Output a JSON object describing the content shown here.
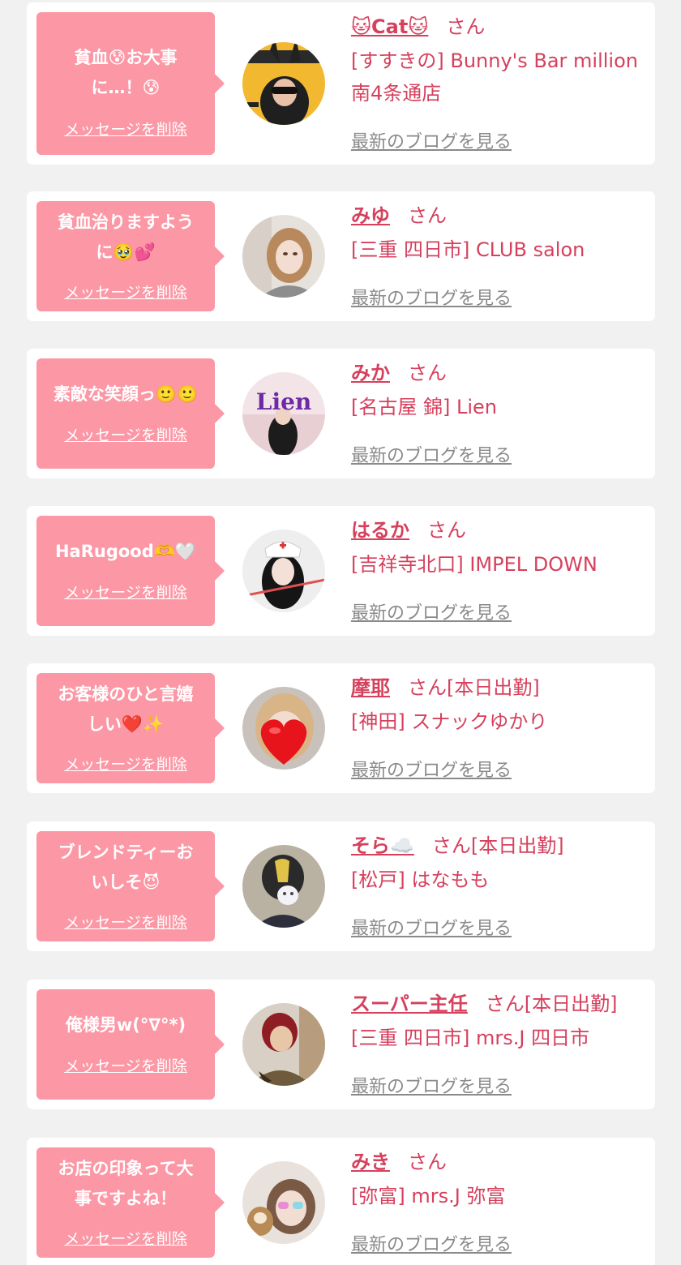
{
  "colors": {
    "background": "#f1f1f1",
    "card": "#ffffff",
    "bubble": "#fc97a5",
    "accent": "#d6405d",
    "link_gray": "#8a8a8a"
  },
  "delete_label": "メッセージを削除",
  "blog_label": "最新のブログを見る",
  "items": [
    {
      "message": "貧血😰お大事\nに…！😰",
      "name": "🐱Cat🐱",
      "honorific": "さん",
      "shop": "[すすきの] Bunny's Bar million\n南4条通店"
    },
    {
      "message": "貧血治りますよう\nに🥹💕",
      "name": "みゆ",
      "honorific": "さん",
      "shop": "[三重 四日市] CLUB salon"
    },
    {
      "message": "素敵な笑顔っ🙂🙂",
      "name": "みか",
      "honorific": "さん",
      "shop": "[名古屋 錦] Lien",
      "avatar_text": "Lien"
    },
    {
      "message": "HaRugood🫶🤍",
      "name": "はるか",
      "honorific": "さん",
      "shop": "[吉祥寺北口] IMPEL DOWN"
    },
    {
      "message": "お客様のひと言嬉\nしい❤️✨",
      "name": "摩耶",
      "honorific": "さん[本日出勤]",
      "shop": "[神田] スナックゆかり"
    },
    {
      "message": "ブレンドティーお\nいしそ😈",
      "name": "そら☁️",
      "honorific": "さん[本日出勤]",
      "shop": "[松戸] はなもも"
    },
    {
      "message": "俺様男w(°∇°*)",
      "name": "スーパー主任",
      "honorific": "さん[本日出勤]",
      "shop": "[三重 四日市] mrs.J 四日市"
    },
    {
      "message": "お店の印象って大\n事ですよね！",
      "name": "みき",
      "honorific": "さん",
      "shop": "[弥富] mrs.J 弥富"
    }
  ]
}
